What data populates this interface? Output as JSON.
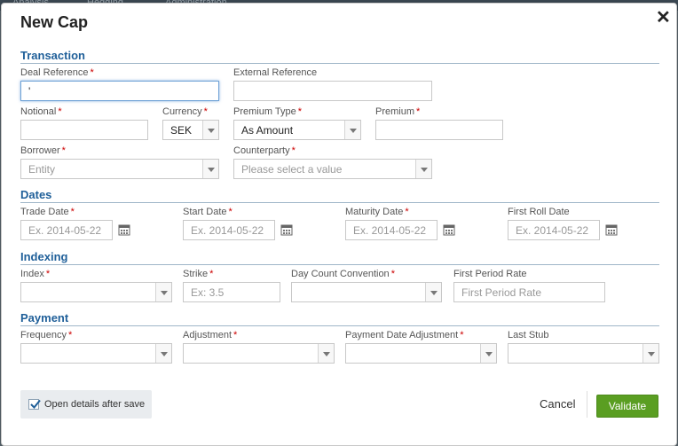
{
  "background_nav": {
    "items": [
      "Analysis",
      "Hedging",
      "Administration"
    ]
  },
  "dialog": {
    "title": "New Cap",
    "close_label": "✕"
  },
  "sections": {
    "transaction": "Transaction",
    "dates": "Dates",
    "indexing": "Indexing",
    "payment": "Payment"
  },
  "required_marker": "*",
  "transaction": {
    "deal_reference": {
      "label": "Deal Reference",
      "value": "'"
    },
    "external_reference": {
      "label": "External Reference",
      "value": ""
    },
    "notional": {
      "label": "Notional",
      "value": ""
    },
    "currency": {
      "label": "Currency",
      "value": "SEK"
    },
    "premium_type": {
      "label": "Premium Type",
      "value": "As Amount"
    },
    "premium": {
      "label": "Premium",
      "value": ""
    },
    "borrower": {
      "label": "Borrower",
      "placeholder": "Entity"
    },
    "counterparty": {
      "label": "Counterparty",
      "placeholder": "Please select a value"
    }
  },
  "dates": {
    "trade_date": {
      "label": "Trade Date",
      "placeholder": "Ex. 2014-05-22"
    },
    "start_date": {
      "label": "Start Date",
      "placeholder": "Ex. 2014-05-22"
    },
    "maturity_date": {
      "label": "Maturity Date",
      "placeholder": "Ex. 2014-05-22"
    },
    "first_roll_date": {
      "label": "First Roll Date",
      "placeholder": "Ex. 2014-05-22"
    }
  },
  "indexing": {
    "index": {
      "label": "Index",
      "value": ""
    },
    "strike": {
      "label": "Strike",
      "placeholder": "Ex: 3.5"
    },
    "day_count": {
      "label": "Day Count Convention",
      "value": ""
    },
    "first_period_rate": {
      "label": "First Period Rate",
      "placeholder": "First Period Rate"
    }
  },
  "payment": {
    "frequency": {
      "label": "Frequency",
      "value": ""
    },
    "adjustment": {
      "label": "Adjustment",
      "value": ""
    },
    "payment_date_adjustment": {
      "label": "Payment Date Adjustment",
      "value": ""
    },
    "last_stub": {
      "label": "Last Stub",
      "value": ""
    }
  },
  "footer": {
    "open_details_label": "Open details after save",
    "open_details_checked": true,
    "cancel_label": "Cancel",
    "validate_label": "Validate"
  },
  "colors": {
    "accent": "#1f5f99",
    "validate": "#5a9e22",
    "required": "#cc0000"
  }
}
